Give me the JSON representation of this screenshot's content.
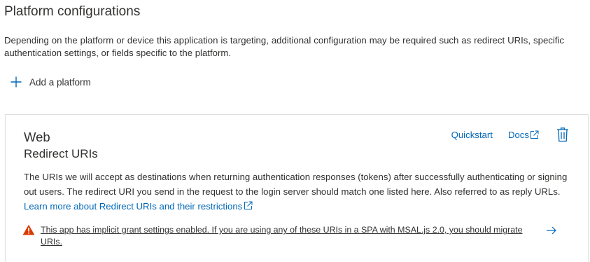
{
  "section": {
    "title": "Platform configurations",
    "description": "Depending on the platform or device this application is targeting, additional configuration may be required such as redirect URIs, specific authentication settings, or fields specific to the platform."
  },
  "add_platform": {
    "label": "Add a platform",
    "icon": "plus-icon"
  },
  "platform_card": {
    "title": "Web",
    "subtitle": "Redirect URIs",
    "quickstart_label": "Quickstart",
    "docs_label": "Docs",
    "description": "The URIs we will accept as destinations when returning authentication responses (tokens) after successfully authenticating or signing out users. The redirect URI you send in the request to the login server should match one listed here. Also referred to as reply URLs.",
    "learn_more_link": "Learn more about Redirect URIs and their restrictions",
    "warning_text": "This app has implicit grant settings enabled. If you are using any of these URIs in a SPA with MSAL.js 2.0, you should migrate URIs.",
    "icons": {
      "docs": "external-link-icon",
      "delete": "trash-icon",
      "warning": "warning-icon",
      "arrow": "arrow-right-icon"
    }
  },
  "colors": {
    "link": "#0067b8",
    "text": "#323130",
    "warning": "#d83b01",
    "border": "#e1dfdd"
  }
}
